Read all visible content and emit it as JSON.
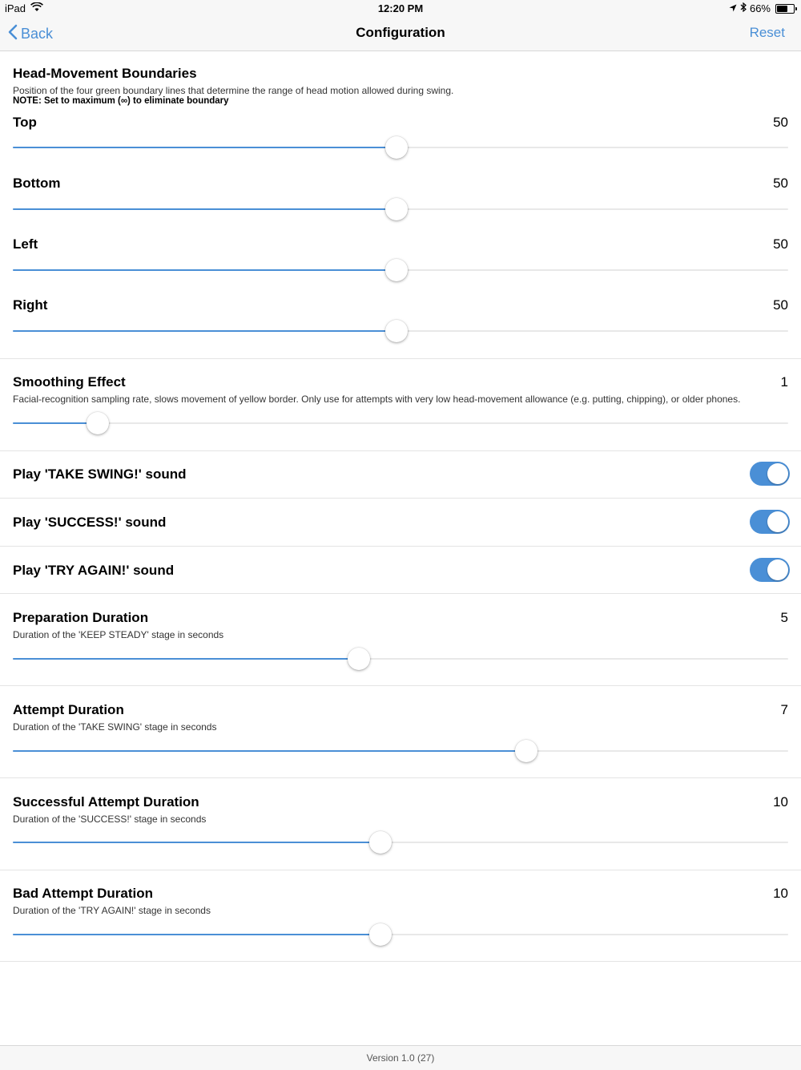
{
  "status_bar": {
    "device": "iPad",
    "time": "12:20 PM",
    "battery": "66%",
    "battery_level": 0.66
  },
  "nav": {
    "back_label": "Back",
    "title": "Configuration",
    "reset_label": "Reset"
  },
  "head_movement": {
    "title": "Head-Movement Boundaries",
    "description": "Position of the four green boundary lines that determine the range of head motion allowed during swing.",
    "note": "NOTE: Set to maximum (∞) to eliminate boundary",
    "sliders": [
      {
        "label": "Top",
        "value": "50",
        "level": 0.495
      },
      {
        "label": "Bottom",
        "value": "50",
        "level": 0.495
      },
      {
        "label": "Left",
        "value": "50",
        "level": 0.495
      },
      {
        "label": "Right",
        "value": "50",
        "level": 0.495
      }
    ]
  },
  "smoothing": {
    "title": "Smoothing Effect",
    "value": "1",
    "description": "Facial-recognition sampling rate, slows movement of yellow border. Only use for attempts with very low head-movement allowance (e.g. putting, chipping), or older phones.",
    "level": 0.11
  },
  "toggles": [
    {
      "label": "Play 'TAKE SWING!' sound",
      "on": true
    },
    {
      "label": "Play 'SUCCESS!' sound",
      "on": true
    },
    {
      "label": "Play 'TRY AGAIN!' sound",
      "on": true
    }
  ],
  "durations": [
    {
      "title": "Preparation Duration",
      "value": "5",
      "description": "Duration of the 'KEEP STEADY' stage in seconds",
      "level": 0.446
    },
    {
      "title": "Attempt Duration",
      "value": "7",
      "description": "Duration of the 'TAKE SWING' stage in seconds",
      "level": 0.662
    },
    {
      "title": "Successful Attempt Duration",
      "value": "10",
      "description": "Duration of the 'SUCCESS!' stage in seconds",
      "level": 0.474
    },
    {
      "title": "Bad Attempt Duration",
      "value": "10",
      "description": "Duration of the 'TRY AGAIN!' stage in seconds",
      "level": 0.474
    }
  ],
  "footer": {
    "version": "Version 1.0 (27)"
  },
  "colors": {
    "accent": "#4a8fd6",
    "track": "#e8e8e8",
    "bar_background": "#f7f7f7"
  }
}
